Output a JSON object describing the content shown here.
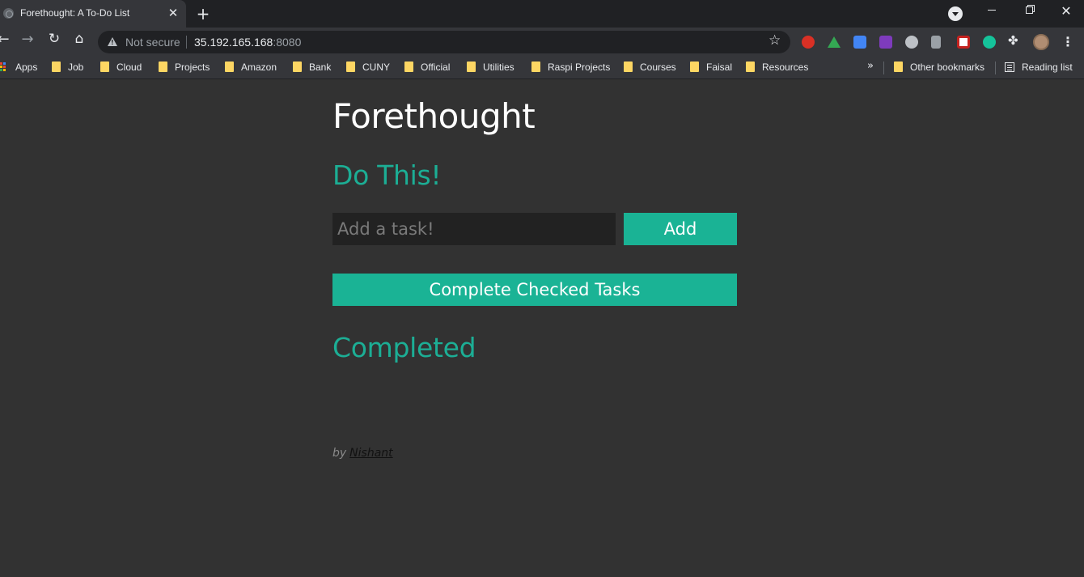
{
  "browser": {
    "tab": {
      "title": "Forethought: A To-Do List",
      "close_glyph": "✕"
    },
    "new_tab_glyph": "+",
    "window_close_glyph": "✕",
    "address": {
      "security_label": "Not secure",
      "host": "35.192.165.168",
      "port": ":8080"
    },
    "bookmarks": [
      {
        "label": "Apps",
        "type": "apps"
      },
      {
        "label": "Job",
        "type": "folder"
      },
      {
        "label": "Cloud",
        "type": "folder"
      },
      {
        "label": "Projects",
        "type": "folder"
      },
      {
        "label": "Amazon",
        "type": "folder"
      },
      {
        "label": "Bank",
        "type": "folder"
      },
      {
        "label": "CUNY",
        "type": "folder"
      },
      {
        "label": "Official",
        "type": "folder"
      },
      {
        "label": "Utilities",
        "type": "folder"
      },
      {
        "label": "Raspi Projects",
        "type": "folder"
      },
      {
        "label": "Courses",
        "type": "folder"
      },
      {
        "label": "Faisal",
        "type": "folder"
      },
      {
        "label": "Resources",
        "type": "folder"
      }
    ],
    "more_glyph": "»",
    "other_bookmarks": "Other bookmarks",
    "reading_list": "Reading list",
    "extensions": [
      "adblock-icon",
      "google-drive-icon",
      "google-translate-icon",
      "onenote-icon",
      "extension-icon",
      "office-icon",
      "todoist-icon",
      "grammarly-icon",
      "puzzle-piece-icon"
    ]
  },
  "app": {
    "title": "Forethought",
    "todo_heading": "Do This!",
    "input_placeholder": "Add a task!",
    "add_label": "Add",
    "complete_label": "Complete Checked Tasks",
    "completed_heading": "Completed",
    "footer_by": "by",
    "footer_author": "Nishant"
  },
  "colors": {
    "accent": "#1ab395",
    "heading_accent": "#1cae95",
    "background": "#323232",
    "input_background": "#222222"
  }
}
